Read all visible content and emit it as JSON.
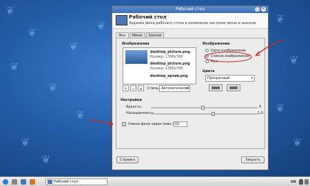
{
  "window": {
    "title": "Рабочий стол",
    "header_title": "Рабочий стол",
    "header_subtitle": "Задание фона рабочего стола и изменение настроек меню и значков"
  },
  "tabs": [
    "Фон",
    "Меню",
    "Значки"
  ],
  "images_section": {
    "label": "Изображения",
    "items": [
      {
        "name": "desktop_picture.png",
        "size": "Размер: 1366x768"
      },
      {
        "name": "desktop_picture.png",
        "size": "Размер: 1366x768"
      },
      {
        "name": "desktop_архив.png"
      }
    ],
    "style_label": "Стиль:",
    "style_value": "Автоматически"
  },
  "image_mode": {
    "label": "Изображение",
    "options": [
      "Одно изображение",
      "Список изображений",
      "Нет"
    ],
    "selected": "Список изображений"
  },
  "colors": {
    "label": "Цвета",
    "mode_value": "Прозрачный"
  },
  "settings": {
    "label": "Настройки",
    "brightness_label": "Яркость:",
    "brightness_value": "0",
    "saturation_label": "Насыщенность:",
    "saturation_value": "1,0",
    "change_label": "Смена фона через (мин.):",
    "change_minutes": "10",
    "change_checked": true
  },
  "buttons": {
    "help": "Справка",
    "close": "Закрыть"
  },
  "taskbar": {
    "task_label": "Рабочий стол",
    "layout_indicator": "us",
    "tray_icons": [
      "network-icon",
      "volume-icon",
      "power-icon"
    ]
  },
  "colors_theme": {
    "accent": "#3d6db3",
    "annotation_red": "#d9231a"
  }
}
